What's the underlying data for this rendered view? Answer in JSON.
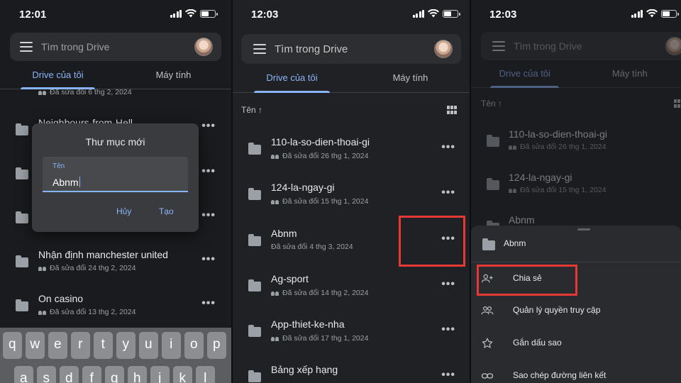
{
  "panel1": {
    "time": "12:01",
    "search_placeholder": "Tìm trong Drive",
    "tabs": [
      "Drive của tôi",
      "Máy tính"
    ],
    "files": [
      {
        "name": "",
        "sub": "Đã sửa đổi 6 thg 2, 2024"
      },
      {
        "name": "Neighbours-from-Hell",
        "sub": ""
      },
      {
        "name": "",
        "sub": ""
      },
      {
        "name": "",
        "sub": ""
      },
      {
        "name": "Nhận định manchester united",
        "sub": "Đã sửa đổi 24 thg 2, 2024"
      },
      {
        "name": "On casino",
        "sub": "Đã sửa đổi 13 thg 2, 2024"
      }
    ],
    "dialog": {
      "title": "Thư mục mới",
      "field_label": "Tên",
      "field_value": "Abnm",
      "cancel": "Hủy",
      "create": "Tạo"
    },
    "keyboard": {
      "row1": [
        "q",
        "w",
        "e",
        "r",
        "t",
        "y",
        "u",
        "i",
        "o",
        "p"
      ],
      "row2": [
        "a",
        "s",
        "d",
        "f",
        "g",
        "h",
        "j",
        "k",
        "l"
      ]
    }
  },
  "panel2": {
    "time": "12:03",
    "search_placeholder": "Tìm trong Drive",
    "tabs": [
      "Drive của tôi",
      "Máy tính"
    ],
    "sort_label": "Tên ↑",
    "files": [
      {
        "name": "110-la-so-dien-thoai-gi",
        "sub": "Đã sửa đổi 26 thg 1, 2024",
        "shared": true
      },
      {
        "name": "124-la-ngay-gi",
        "sub": "Đã sửa đổi 15 thg 1, 2024",
        "shared": true
      },
      {
        "name": "Abnm",
        "sub": "Đã sửa đổi 4 thg 3, 2024",
        "shared": false
      },
      {
        "name": "Ag-sport",
        "sub": "Đã sửa đổi 14 thg 2, 2024",
        "shared": true
      },
      {
        "name": "App-thiet-ke-nha",
        "sub": "Đã sửa đổi 17 thg 1, 2024",
        "shared": true
      },
      {
        "name": "Bảng xếp hạng",
        "sub": "",
        "shared": true
      }
    ]
  },
  "panel3": {
    "time": "12:03",
    "search_placeholder": "Tìm trong Drive",
    "tabs": [
      "Drive của tôi",
      "Máy tính"
    ],
    "sort_label": "Tên ↑",
    "files": [
      {
        "name": "110-la-so-dien-thoai-gi",
        "sub": "Đã sửa đổi 26 thg 1, 2024"
      },
      {
        "name": "124-la-ngay-gi",
        "sub": "Đã sửa đổi 15 thg 1, 2024"
      },
      {
        "name": "Abnm",
        "sub": ""
      }
    ],
    "sheet": {
      "title": "Abnm",
      "items": [
        "Chia sẻ",
        "Quản lý quyền truy cập",
        "Gắn dấu sao",
        "Sao chép đường liên kết"
      ]
    }
  },
  "colors": {
    "accent": "#8ab4f8",
    "highlight": "#e53935",
    "background": "#202124"
  }
}
